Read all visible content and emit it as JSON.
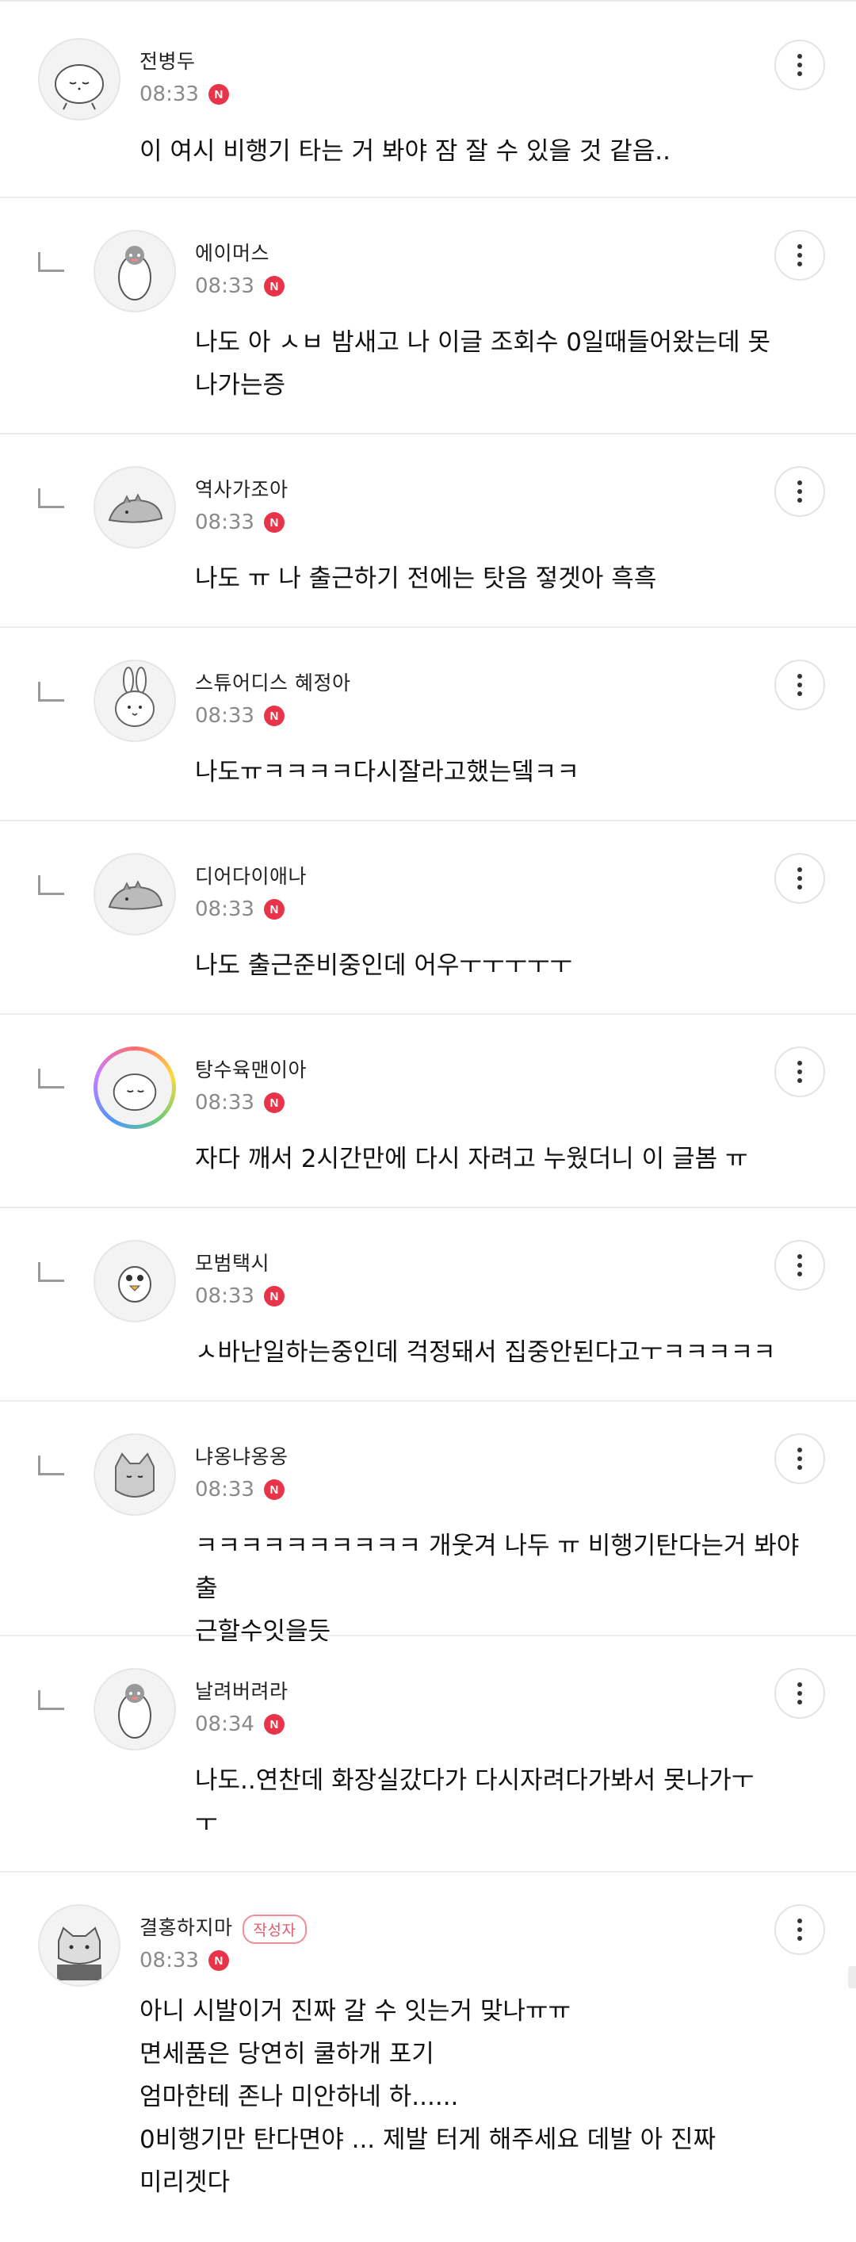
{
  "comments": [
    {
      "nickname": "전병두",
      "time": "08:33",
      "new_badge": "N",
      "author_tag": "",
      "text": "이 여시 비행기 타는 거 봐야 잠 잘 수 있을 것 같음..",
      "reply": false,
      "avatar_icon": "sleepy-blob-avatar-icon"
    },
    {
      "nickname": "에이머스",
      "time": "08:33",
      "new_badge": "N",
      "author_tag": "",
      "text": "나도 아 ㅅㅂ 밤새고 나 이글 조회수 0일때들어왔는데 못\n나가는증",
      "reply": true,
      "avatar_icon": "penguin-avatar-icon"
    },
    {
      "nickname": "역사가조아",
      "time": "08:33",
      "new_badge": "N",
      "author_tag": "",
      "text": "나도 ㅠ 나 출근하기 전에는 탓음 젛겟아 흑흑",
      "reply": true,
      "avatar_icon": "dinosaur-avatar-icon"
    },
    {
      "nickname": "스튜어디스 혜정아",
      "time": "08:33",
      "new_badge": "N",
      "author_tag": "",
      "text": "나도ㅠㅋㅋㅋㅋ다시잘라고했는뎈ㅋㅋ",
      "reply": true,
      "avatar_icon": "bunny-avatar-icon"
    },
    {
      "nickname": "디어다이애나",
      "time": "08:33",
      "new_badge": "N",
      "author_tag": "",
      "text": "나도 출근준비중인데 어우ㅜㅜㅜㅜㅜ",
      "reply": true,
      "avatar_icon": "dinosaur-avatar-icon"
    },
    {
      "nickname": "탕수육맨이아",
      "time": "08:33",
      "new_badge": "N",
      "author_tag": "",
      "text": "자다 깨서 2시간만에 다시 자려고 누웠더니 이 글봄 ㅠ",
      "reply": true,
      "avatar_icon": "rainbow-blob-avatar-icon"
    },
    {
      "nickname": "모범택시",
      "time": "08:33",
      "new_badge": "N",
      "author_tag": "",
      "text": "ㅅ바난일하는중인데 걱정돼서 집중안된다고ㅜㅋㅋㅋㅋㅋ",
      "reply": true,
      "avatar_icon": "chick-avatar-icon"
    },
    {
      "nickname": "냐옹냐옹옹",
      "time": "08:33",
      "new_badge": "N",
      "author_tag": "",
      "text": "ㅋㅋㅋㅋㅋㅋㅋㅋㅋㅋ 개웃겨 나두 ㅠ 비행기탄다는거 봐야 출\n근할수잇을듯",
      "reply": true,
      "avatar_icon": "cat-avatar-icon"
    },
    {
      "nickname": "날려버려라",
      "time": "08:34",
      "new_badge": "N",
      "author_tag": "",
      "text": "나도..연찬데 화장실갔다가 다시자려다가봐서 못나가ㅜ\nㅜ",
      "reply": true,
      "avatar_icon": "penguin-avatar-icon"
    },
    {
      "nickname": "결홍하지마",
      "time": "08:33",
      "new_badge": "N",
      "author_tag": "작성자",
      "text": "아니 시발이거 진짜 갈 수 잇는거 맞나ㅠㅠ\n면세품은 당연히 쿨하개 포기\n엄마한테 존나 미안하네 하......\n0비행기만 탄다면야 ... 제발 터게 해주세요 데발 아 진짜\n미리겟다",
      "reply": false,
      "avatar_icon": "grey-cat-avatar-icon"
    }
  ]
}
